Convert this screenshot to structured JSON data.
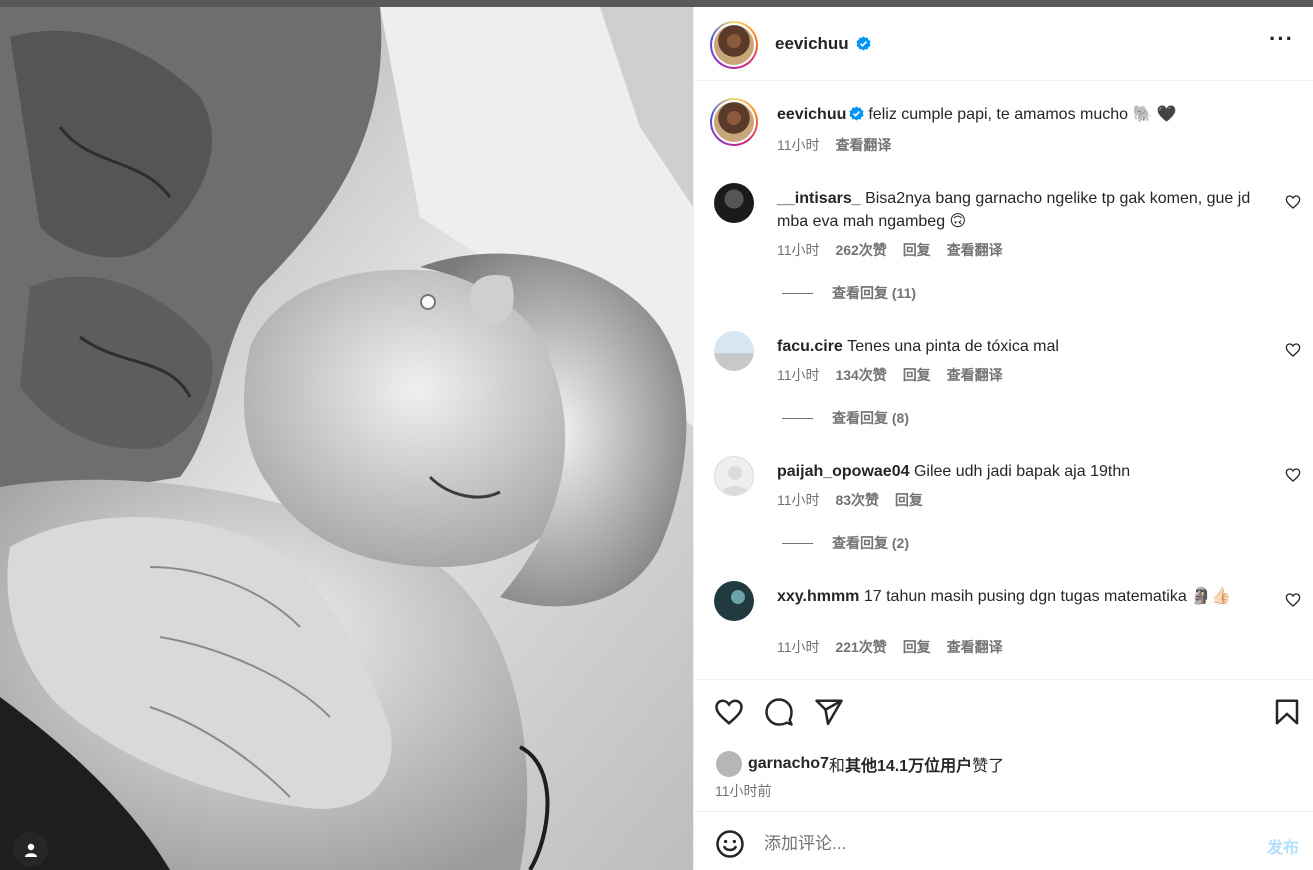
{
  "post": {
    "author": "eevichuu",
    "caption_user": "eevichuu",
    "caption_text": "feliz cumple papi, te amamos mucho 🐘 🖤",
    "caption_time": "11小时",
    "caption_translate": "查看翻译"
  },
  "comments": [
    {
      "user": "__intisars_",
      "text": "Bisa2nya bang garnacho ngelike tp gak komen, gue jd mba eva mah ngambeg 🙃",
      "time": "11小时",
      "likes": "262次赞",
      "reply": "回复",
      "translate": "查看翻译",
      "view_replies": "查看回复 (11)"
    },
    {
      "user": "facu.cire",
      "text": "Tenes una pinta de tóxica mal",
      "time": "11小时",
      "likes": "134次赞",
      "reply": "回复",
      "translate": "查看翻译",
      "view_replies": "查看回复 (8)"
    },
    {
      "user": "paijah_opowae04",
      "text": "Gilee udh jadi bapak aja 19thn",
      "time": "11小时",
      "likes": "83次赞",
      "reply": "回复",
      "view_replies": "查看回复 (2)"
    },
    {
      "user": "xxy.hmmm",
      "text": "17 tahun masih pusing dgn tugas matematika 🗿👍🏻",
      "time": "11小时",
      "likes": "221次赞",
      "reply": "回复",
      "translate": "查看翻译"
    }
  ],
  "likes_line": {
    "user": "garnacho7",
    "connector": "和",
    "others": "其他14.1万位用户",
    "suffix": "赞了"
  },
  "post_time": "11小时前",
  "add_comment": {
    "placeholder": "添加评论...",
    "post_label": "发布"
  },
  "icons": {
    "more": "more-options-icon",
    "like": "heart-icon",
    "comment": "comment-icon",
    "share": "send-icon",
    "save": "bookmark-icon",
    "emoji": "emoji-icon",
    "verified": "verified-badge-icon",
    "tag": "user-tag-icon"
  },
  "colors": {
    "verified": "#0095f6",
    "post_btn_disabled": "#b2dffc",
    "secondary_text": "#737373"
  }
}
